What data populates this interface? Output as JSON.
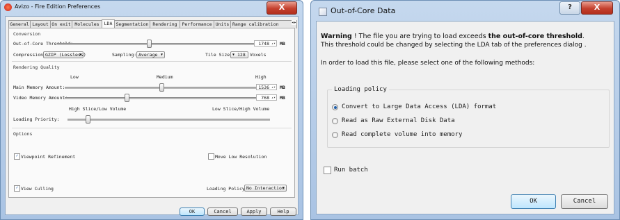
{
  "prefs": {
    "title": "Avizo - Fire Edition Preferences",
    "close": "X",
    "tabs": [
      "General",
      "Layout",
      "On exit",
      "Molecules",
      "LDA",
      "Segmentation",
      "Rendering",
      "Performance",
      "Units",
      "Range calibration"
    ],
    "tab_more": "◂▸",
    "conversion": {
      "section": "Conversion",
      "threshold_label": "Out-of-Core Threshold:",
      "threshold_value": "1748",
      "threshold_unit": "MB",
      "threshold_level": 0.43,
      "compression_label": "Compression:",
      "compression_value": "GZIP (Lossless)",
      "sampling_label": "Sampling:",
      "sampling_value": "Average",
      "tile_label": "Tile Size:",
      "tile_value": "128",
      "tile_unit": "Voxels"
    },
    "rendering": {
      "section": "Rendering Quality",
      "low": "Low",
      "medium": "Medium",
      "high": "High",
      "main_label": "Main Memory Amount:",
      "main_value": "1536",
      "main_unit": "MB",
      "main_level": 0.47,
      "video_label": "Video Memory Amount:",
      "video_value": "768",
      "video_unit": "MB",
      "video_level": 0.3,
      "left_hint": "High Slice/Low Volume",
      "right_hint": "Low Slice/High Volume",
      "loading_label": "Loading Priority:",
      "loading_level": 0.1
    },
    "options": {
      "section": "Options",
      "viewpoint": "Viewpoint Refinement",
      "move_low": "Move Low Resolution",
      "view_culling": "View Culling",
      "policy_label": "Loading Policy:",
      "policy_value": "No Interaction"
    },
    "buttons": {
      "ok": "OK",
      "cancel": "Cancel",
      "apply": "Apply",
      "help": "Help"
    }
  },
  "dialog": {
    "title": "Out-of-Core Data",
    "help": "?",
    "close": "X",
    "warning_bold": "Warning",
    "warning_mid": " ! The file you are trying to load exceeds ",
    "warning_bold2": "the out-of-core threshold",
    "warning_end": ".",
    "line2": "This threshold could be changed by selecting the LDA tab of the preferences dialog .",
    "line3": "In order to load this file, please select one of the following methods:",
    "policy_group": "Loading policy",
    "options": [
      "Convert to Large Data Access (LDA) format",
      "Read as Raw External Disk Data",
      "Read complete volume into memory"
    ],
    "run_batch": "Run batch",
    "ok": "OK",
    "cancel": "Cancel"
  }
}
